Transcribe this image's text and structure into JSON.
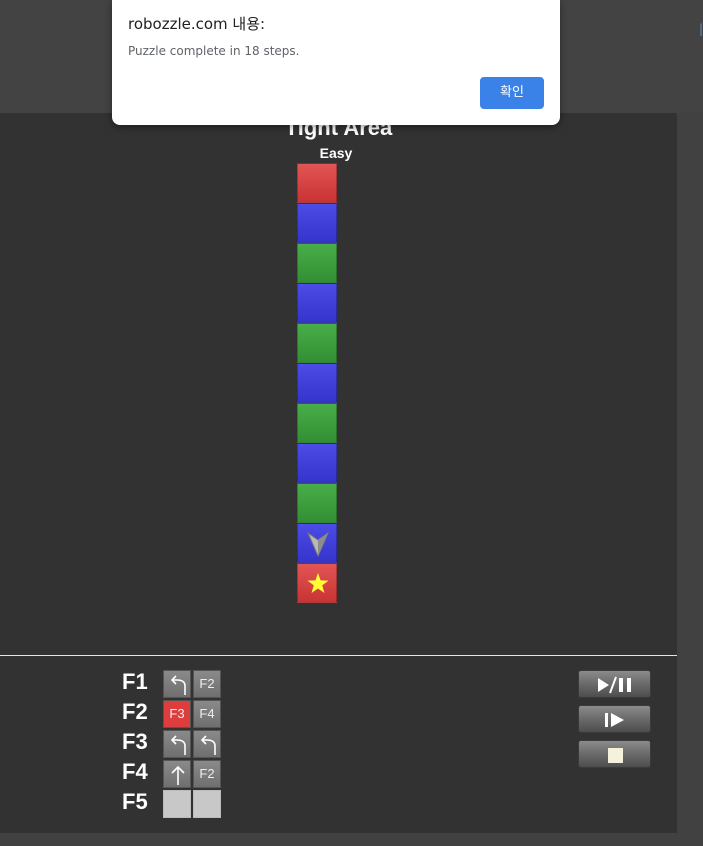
{
  "dialog": {
    "title": "robozzle.com 내용:",
    "message": "Puzzle complete in 18 steps.",
    "ok_label": "확인"
  },
  "puzzle": {
    "title": "Tight Area",
    "difficulty": "Easy",
    "board_column_top_to_bottom": [
      "red",
      "blue",
      "green",
      "blue",
      "green",
      "blue",
      "green",
      "blue",
      "green",
      "blue",
      "red"
    ],
    "robot": {
      "row": 9,
      "facing": "down"
    },
    "star": {
      "row": 10
    }
  },
  "functions": [
    {
      "label": "F1",
      "slots": [
        {
          "type": "icon",
          "icon": "turn-left-icon",
          "color": "gray"
        },
        {
          "type": "call",
          "text": "F2",
          "color": "gray"
        }
      ]
    },
    {
      "label": "F2",
      "slots": [
        {
          "type": "call",
          "text": "F3",
          "color": "red"
        },
        {
          "type": "call",
          "text": "F4",
          "color": "gray"
        }
      ]
    },
    {
      "label": "F3",
      "slots": [
        {
          "type": "icon",
          "icon": "turn-left-icon",
          "color": "gray"
        },
        {
          "type": "icon",
          "icon": "turn-left-icon",
          "color": "gray"
        }
      ]
    },
    {
      "label": "F4",
      "slots": [
        {
          "type": "icon",
          "icon": "forward-arrow-icon",
          "color": "gray"
        },
        {
          "type": "call",
          "text": "F2",
          "color": "gray"
        }
      ]
    },
    {
      "label": "F5",
      "slots": [
        {
          "type": "empty",
          "color": "light-gray"
        },
        {
          "type": "empty",
          "color": "light-gray"
        }
      ]
    }
  ],
  "controls": [
    {
      "name": "play-pause-button",
      "icon": "play-pause-icon"
    },
    {
      "name": "step-button",
      "icon": "step-icon"
    },
    {
      "name": "stop-button",
      "icon": "stop-icon"
    }
  ],
  "colors": {
    "red": "#d63a3a",
    "blue": "#3f3fd9",
    "green": "#3c9e3c",
    "board_bg": "#323232",
    "accent_button": "#3b82e8",
    "star": "#ffff33"
  }
}
